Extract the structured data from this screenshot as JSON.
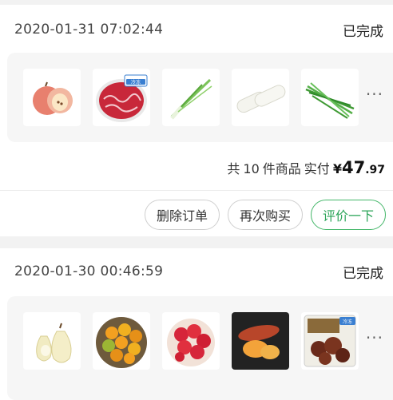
{
  "orders": [
    {
      "date": "2020-01-31 07:02:44",
      "status": "已完成",
      "items": [
        {
          "icon": "apple-icon"
        },
        {
          "icon": "frozen-beef-icon",
          "badge": "冷冻"
        },
        {
          "icon": "scallion-icon"
        },
        {
          "icon": "radish-icon"
        },
        {
          "icon": "chives-icon"
        }
      ],
      "more": "···",
      "summary": {
        "count_prefix": "共",
        "count": "10",
        "count_suffix": "件商品",
        "paid_label": "实付",
        "currency": "¥",
        "price_int": "47",
        "price_dec": ".97"
      },
      "actions": {
        "delete": "删除订单",
        "rebuy": "再次购买",
        "review": "评价一下"
      }
    },
    {
      "date": "2020-01-30 00:46:59",
      "status": "已完成",
      "items": [
        {
          "icon": "pear-icon"
        },
        {
          "icon": "kumquat-icon"
        },
        {
          "icon": "raspberry-icon"
        },
        {
          "icon": "sweet-potato-icon"
        },
        {
          "icon": "frozen-beef-pack-icon",
          "badge": "冷冻"
        }
      ],
      "more": "···"
    }
  ],
  "colors": {
    "accent_green": "#2da55a",
    "background": "#f2f2f2",
    "card": "#ffffff",
    "goods_box": "#f6f6f6"
  }
}
